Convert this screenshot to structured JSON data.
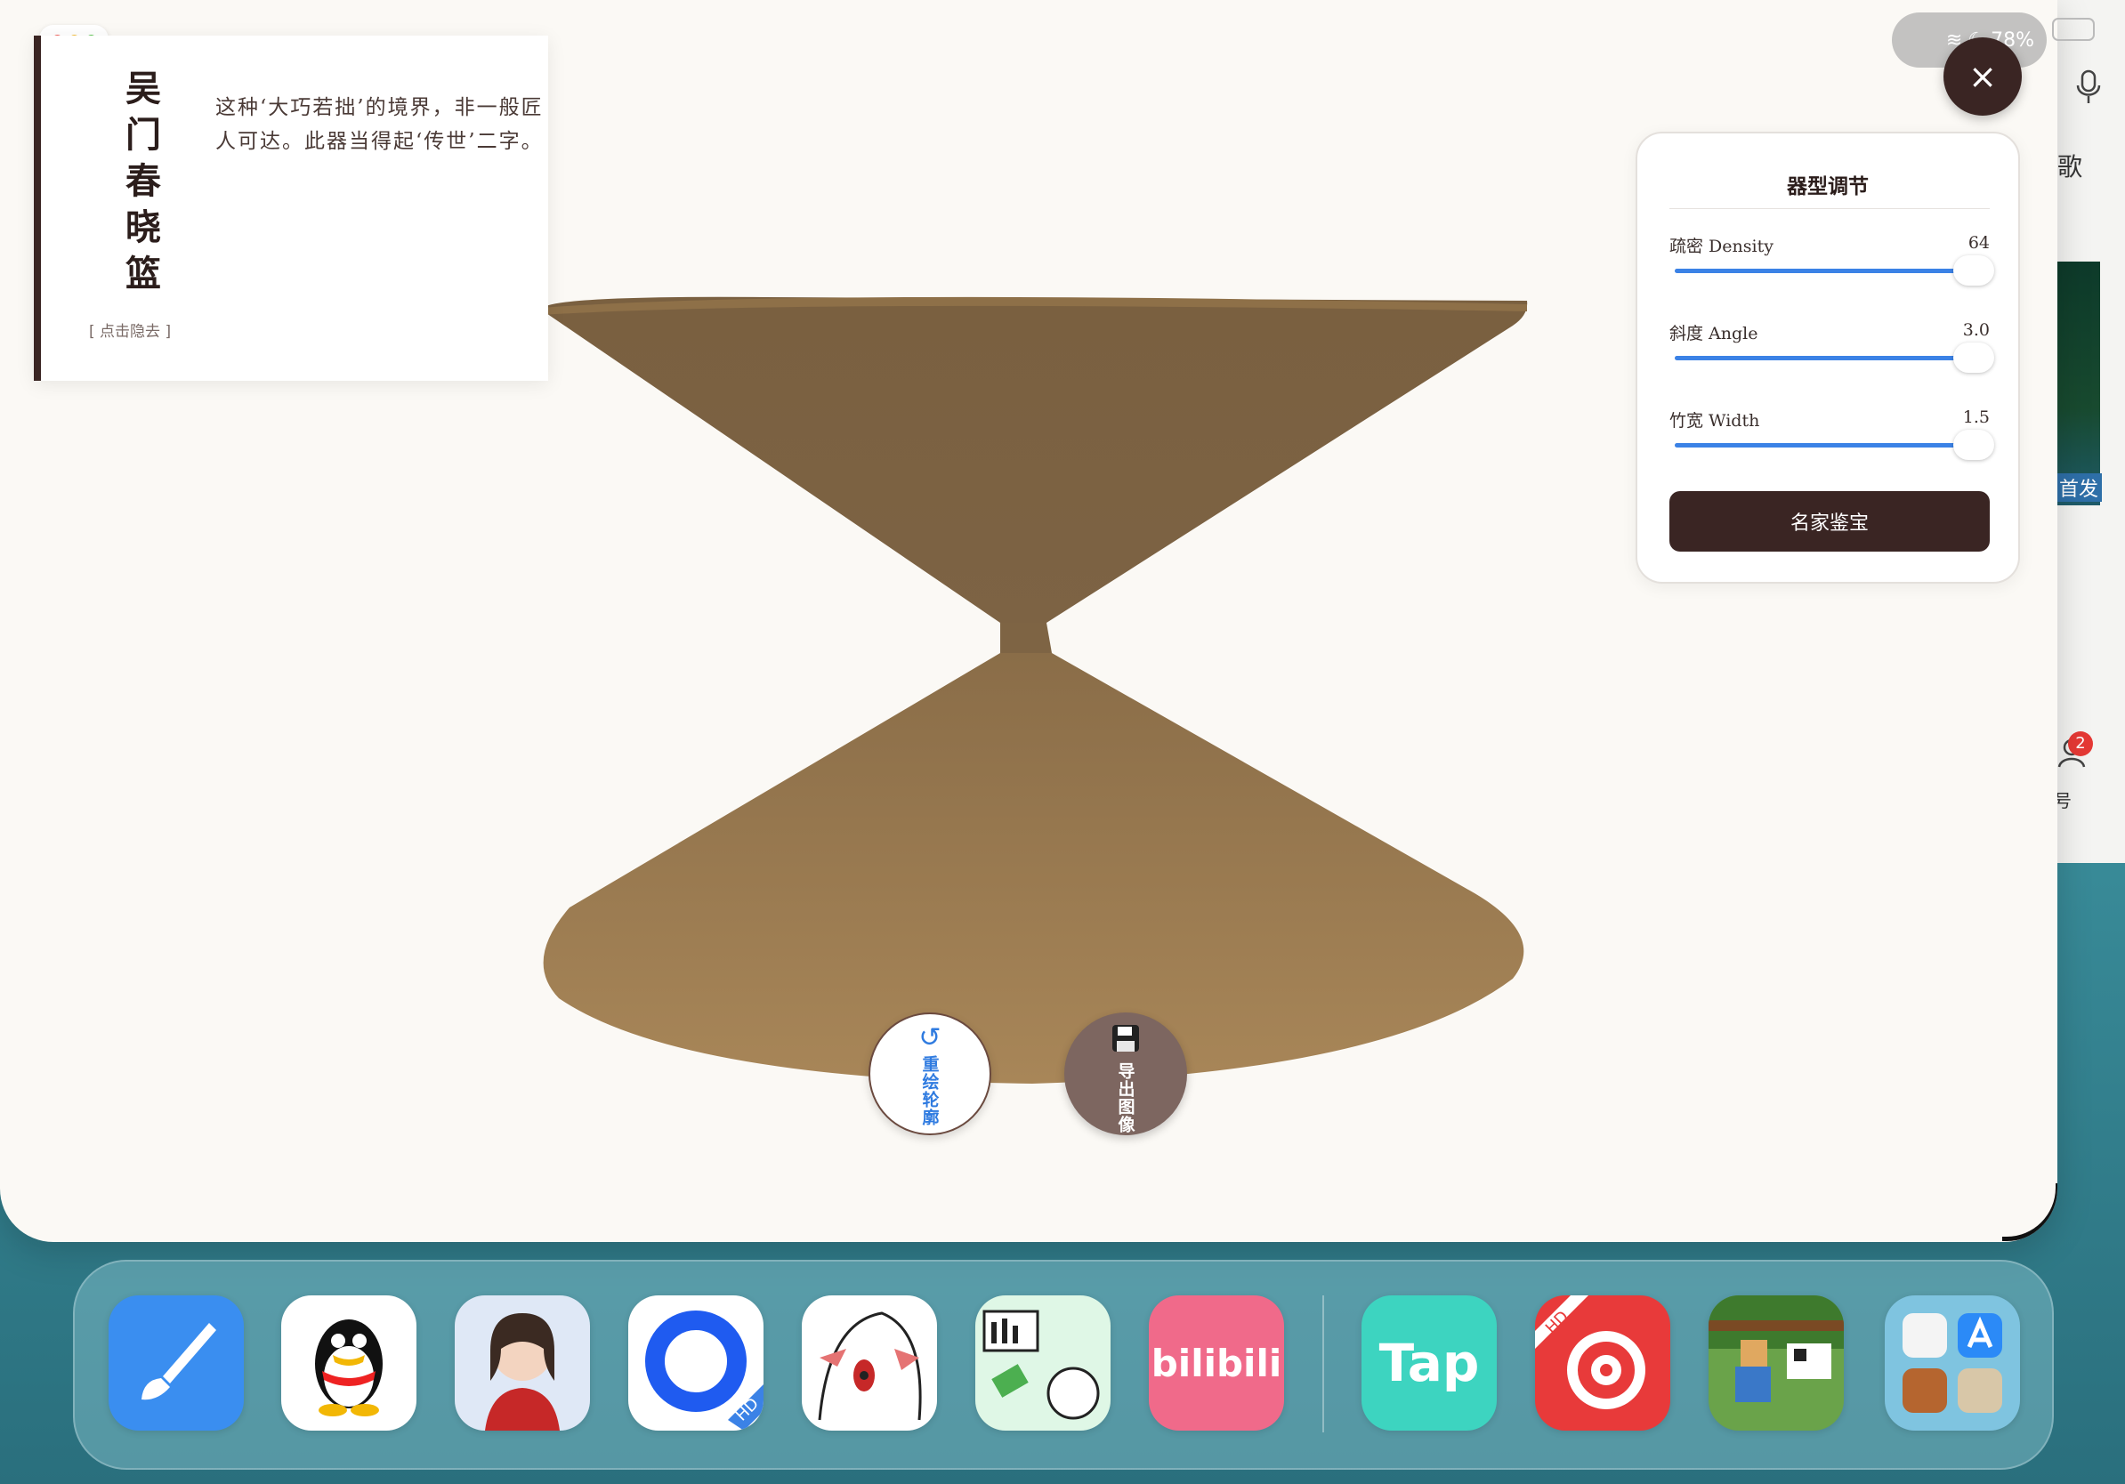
{
  "status_bar": {
    "battery": "78%"
  },
  "background_app": {
    "text_song": "歌",
    "text_first": "首发",
    "text_account": "号",
    "badge": "2"
  },
  "info_card": {
    "title": "吴门春晓篮",
    "body": "这种‘大巧若拙’的境界，非一般匠人可达。此器当得起‘传世’二字。",
    "hide_hint": "[ 点击隐去 ]"
  },
  "controls": {
    "title": "器型调节",
    "sliders": [
      {
        "label": "疏密 Density",
        "value": "64",
        "fill": 0.96
      },
      {
        "label": "斜度 Angle",
        "value": "3.0",
        "fill": 0.96
      },
      {
        "label": "竹宽 Width",
        "value": "1.5",
        "fill": 0.96
      }
    ],
    "appraise_button": "名家鉴宝"
  },
  "actions": {
    "redraw_label": "重绘轮廓",
    "export_label": "导出图像"
  },
  "close_icon": "×",
  "colors": {
    "accent_dark": "#3a2523",
    "slider_blue": "#3b82e6",
    "vessel_top": "#7a6040",
    "vessel_bottom": "#a88658"
  },
  "dock": {
    "apps": [
      {
        "name": "paintbrush-app-icon",
        "bg": "#3a8ef0"
      },
      {
        "name": "qq-app-icon",
        "bg": "#ffffff"
      },
      {
        "name": "avatar-app-icon",
        "bg": "#dfe8f6"
      },
      {
        "name": "browser-hd-app-icon",
        "bg": "#ffffff",
        "badge": "HD"
      },
      {
        "name": "anime-character-app-icon",
        "bg": "#ffffff"
      },
      {
        "name": "comic-app-icon",
        "bg": "#dff7e6"
      },
      {
        "name": "bilibili-app-icon",
        "bg": "#f06a8a",
        "label": "bilibili"
      },
      {
        "name": "taptap-app-icon",
        "bg": "#3dd4c0",
        "label": "Tap"
      },
      {
        "name": "netease-music-hd-app-icon",
        "bg": "#e83a3a",
        "badge": "HD"
      },
      {
        "name": "farm-game-app-icon",
        "bg": "#6aa34a"
      },
      {
        "name": "app-library-icon",
        "bg": "#7fc4e0"
      }
    ]
  }
}
